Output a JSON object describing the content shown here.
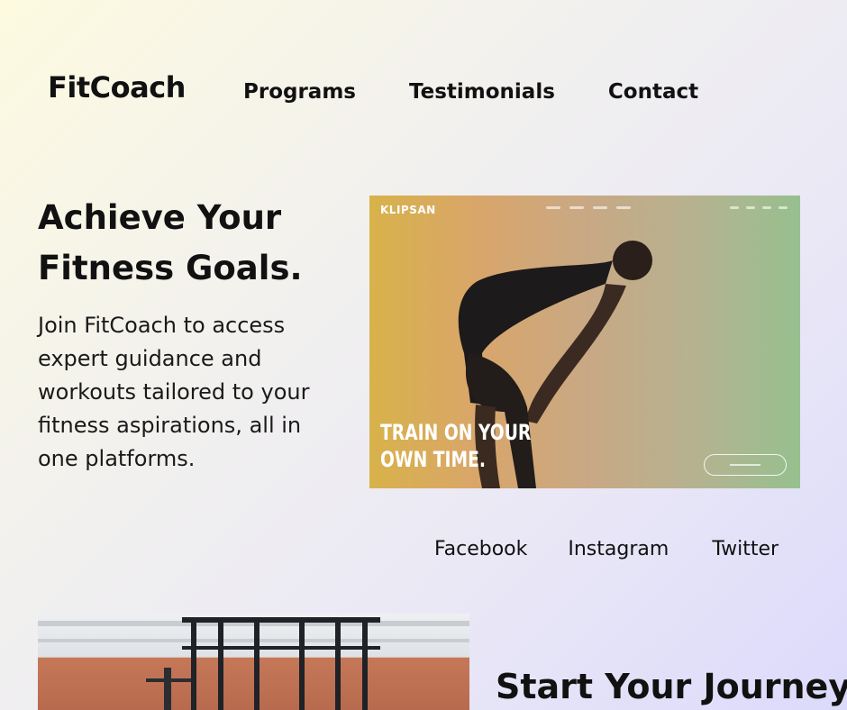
{
  "header": {
    "logo": "FitCoach",
    "nav": [
      "Programs",
      "Testimonials",
      "Contact"
    ]
  },
  "hero": {
    "title": "Achieve Your Fitness Goals.",
    "description": "Join FitCoach to access expert guidance and workouts tailored to your fitness aspirations, all in one platforms.",
    "image": {
      "brand": "KLIPSAN",
      "tagline": "TRAIN ON YOUR\nOWN TIME."
    }
  },
  "social": {
    "links": [
      "Facebook",
      "Instagram",
      "Twitter"
    ]
  },
  "journey": {
    "title": "Start Your Journey"
  },
  "colors": {
    "background_start": "#fdfae0",
    "background_end": "#dcdafb",
    "text": "#111111"
  }
}
